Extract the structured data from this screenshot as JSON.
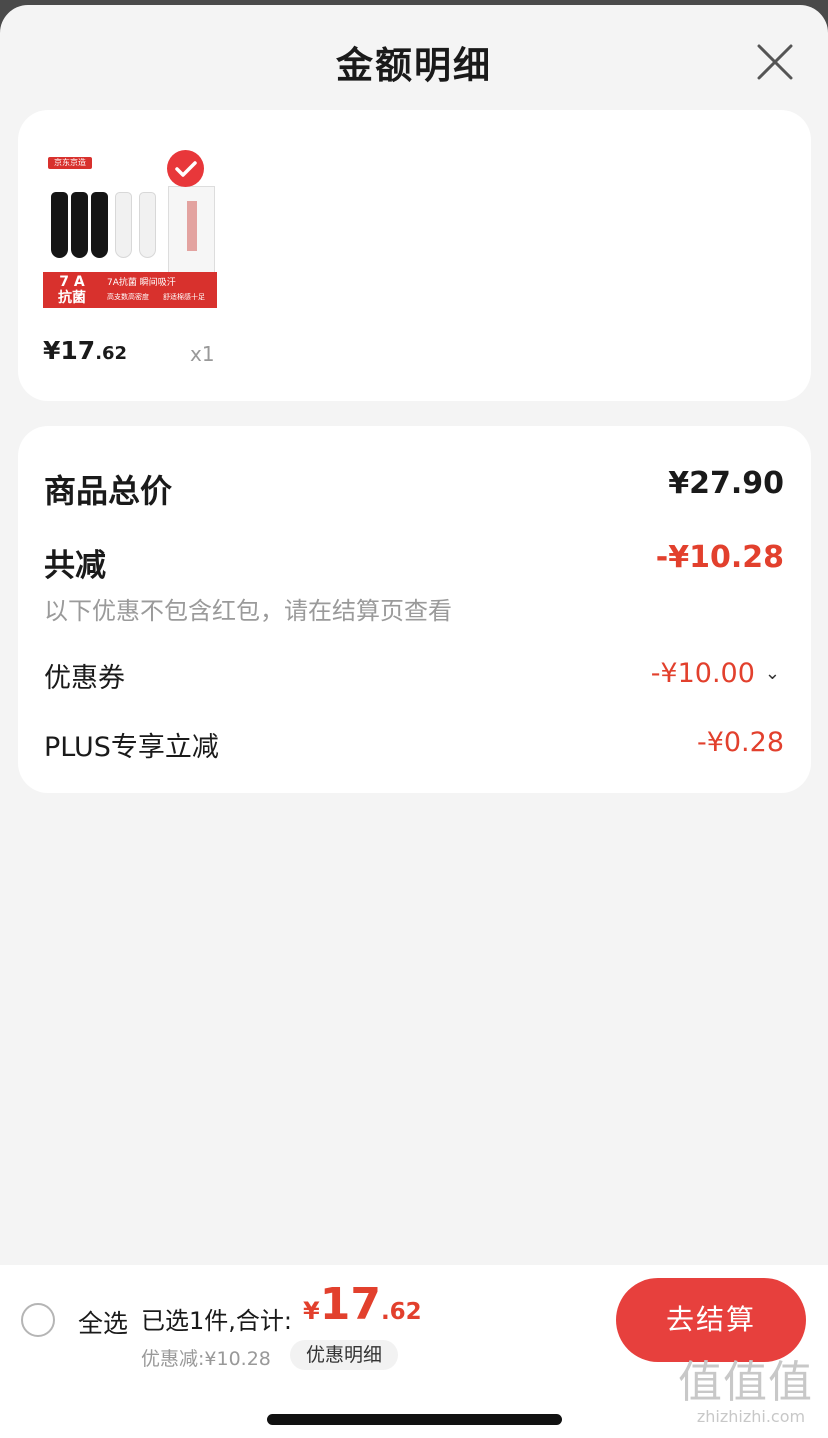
{
  "header": {
    "title": "金额明细"
  },
  "item": {
    "brand_tag": "京东京造",
    "banner_big": "7 A\n抗菌",
    "banner_line1": "7A抗菌  瞬间吸汗",
    "banner_line2": "高支数高密度",
    "banner_line3": "舒适棉感十足",
    "price_int": "¥17",
    "price_dec": ".62",
    "quantity": "x1"
  },
  "summary": {
    "total_label": "商品总价",
    "total_value": "¥27.90",
    "reduction_label": "共减",
    "reduction_value": "-¥10.28",
    "note": "以下优惠不包含红包，请在结算页查看",
    "coupon_label": "优惠券",
    "coupon_value": "-¥10.00",
    "plus_label": "PLUS专享立减",
    "plus_value": "-¥0.28"
  },
  "bottom": {
    "select_all": "全选",
    "selected_text": "已选1件,合计:",
    "currency": "¥",
    "total_int": "17",
    "total_dec": ".62",
    "discount_text": "优惠减:¥10.28",
    "detail_button": "优惠明细",
    "checkout_button": "去结算"
  },
  "watermark": {
    "chars": "值值值",
    "url": "zhizhizhi.com"
  },
  "colors": {
    "accent_red": "#e2402d",
    "checkout_red": "#e7403d",
    "background": "#f4f4f4"
  }
}
